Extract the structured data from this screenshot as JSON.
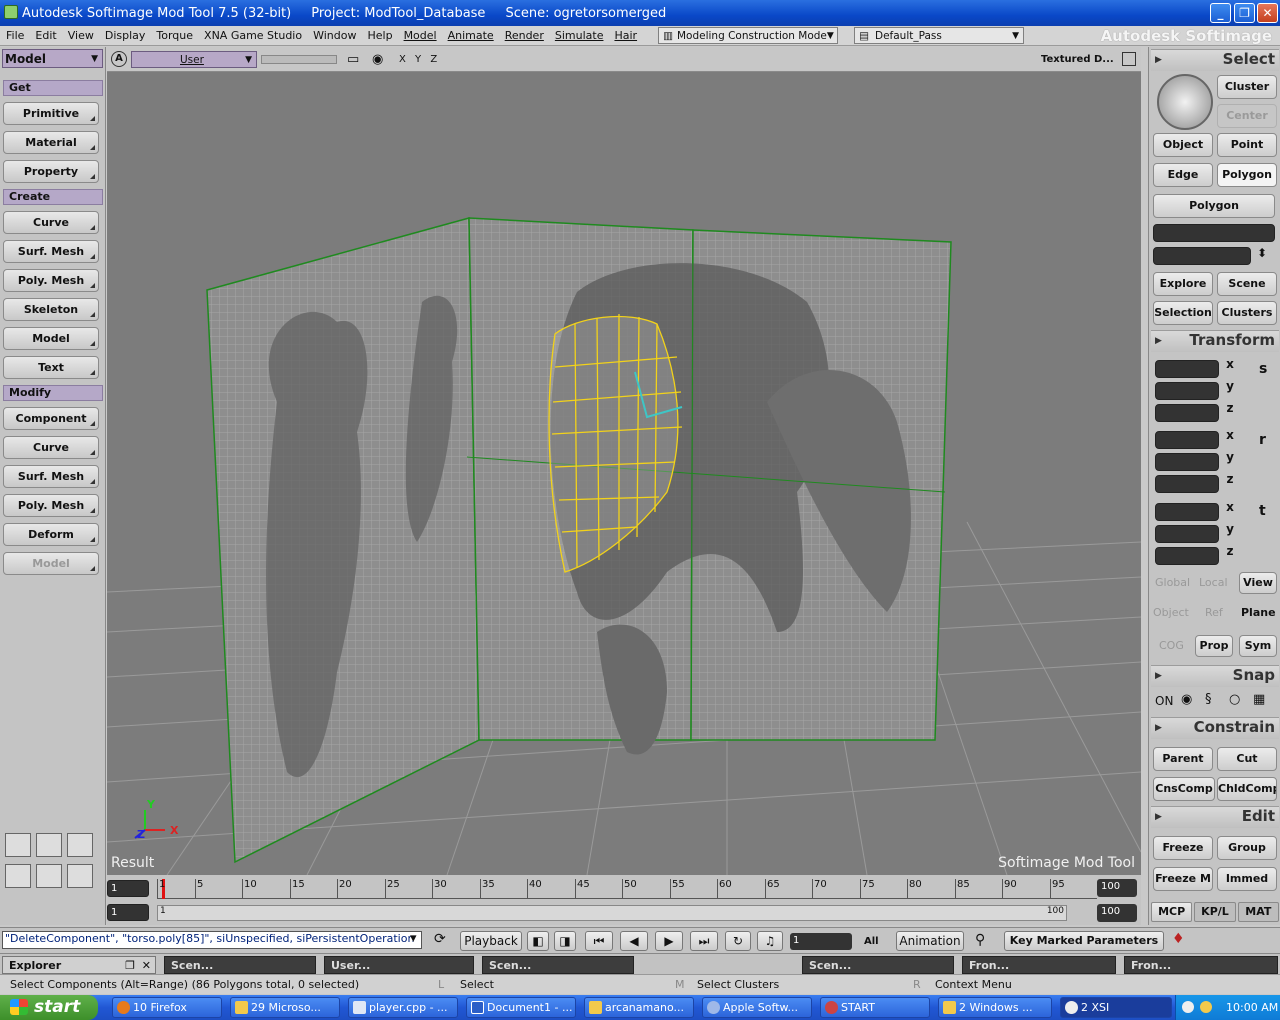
{
  "titlebar": {
    "app": "Autodesk Softimage Mod Tool 7.5 (32-bit)",
    "project": "Project: ModTool_Database",
    "scene": "Scene: ogretorsomerged"
  },
  "menubar": {
    "items": [
      "File",
      "Edit",
      "View",
      "Display",
      "Torque",
      "XNA Game Studio",
      "Window",
      "Help",
      "Model",
      "Animate",
      "Render",
      "Simulate",
      "Hair"
    ],
    "mode": "Modeling Construction Mode",
    "pass": "Default_Pass",
    "brand": "Autodesk Softimage"
  },
  "left": {
    "toolbar": "Model",
    "get_header": "Get",
    "get_items": [
      "Primitive",
      "Material",
      "Property"
    ],
    "create_header": "Create",
    "create_items": [
      "Curve",
      "Surf. Mesh",
      "Poly. Mesh",
      "Skeleton",
      "Model",
      "Text"
    ],
    "modify_header": "Modify",
    "modify_items": [
      "Component",
      "Curve",
      "Surf. Mesh",
      "Poly. Mesh",
      "Deform",
      "Model"
    ]
  },
  "viewport": {
    "camera": "User",
    "axes": "X Y Z",
    "display_mode": "Textured D...",
    "result_label": "Result",
    "watermark": "Softimage  Mod  Tool",
    "axis_x": "X",
    "axis_y": "Y",
    "axis_z": "Z"
  },
  "timeline": {
    "ticks": [
      "1",
      "5",
      "10",
      "15",
      "20",
      "25",
      "30",
      "35",
      "40",
      "45",
      "50",
      "55",
      "60",
      "65",
      "70",
      "75",
      "80",
      "85",
      "90",
      "95"
    ],
    "start": "1",
    "end": "100",
    "range_end": "100",
    "range_end2": "100",
    "range_start": "1",
    "current": "1"
  },
  "right": {
    "select_header": "Select",
    "cluster": "Cluster",
    "center": "Center",
    "object": "Object",
    "point": "Point",
    "edge": "Edge",
    "polygon": "Polygon",
    "polygon_menu": "Polygon",
    "explore": "Explore",
    "scene": "Scene",
    "selection": "Selection",
    "clusters": "Clusters",
    "transform_header": "Transform",
    "axes": [
      "x",
      "y",
      "z"
    ],
    "transform_icons": [
      "s",
      "r",
      "t"
    ],
    "global": "Global",
    "local": "Local",
    "view": "View",
    "object_ref": "Object",
    "ref": "Ref",
    "plane": "Plane",
    "cog": "COG",
    "prop": "Prop",
    "sym": "Sym",
    "snap_header": "Snap",
    "on": "ON",
    "constrain_header": "Constrain",
    "parent": "Parent",
    "cut": "Cut",
    "cnscomp": "CnsComp",
    "chldcomp": "ChldComp",
    "edit_header": "Edit",
    "freeze": "Freeze",
    "group": "Group",
    "freeze_m": "Freeze M",
    "immed": "Immed",
    "tabs": [
      "MCP",
      "KP/L",
      "MAT"
    ]
  },
  "command": {
    "line": "\"DeleteComponent\", \"torso.poly[85]\", siUnspecified, siPersistentOperation",
    "playback": "Playback",
    "frame": "1",
    "all": "All",
    "animation": "Animation",
    "key_marked": "Key Marked Parameters"
  },
  "tabs": {
    "explorer": "Explorer",
    "items": [
      "Scen...",
      "User...",
      "Scen...",
      "Scen...",
      "Fron...",
      "Fron..."
    ]
  },
  "status": {
    "message": "Select Components (Alt=Range) (86 Polygons total, 0 selected)",
    "l_label": "L",
    "l_action": "Select",
    "m_label": "M",
    "m_action": "Select Clusters",
    "r_label": "R",
    "r_action": "Context Menu"
  },
  "taskbar": {
    "start": "start",
    "tasks": [
      "10 Firefox",
      "29 Microso...",
      "player.cpp - ...",
      "Document1 - ...",
      "arcanamano...",
      "Apple Softw...",
      "START",
      "2 Windows ...",
      "2 XSI"
    ],
    "clock": "10:00 AM"
  },
  "colors": {
    "title_blue": "#0a48c8",
    "header_purple": "#b5a8c8",
    "viewport_gray": "#7c7c7c",
    "wire_yellow": "#f2d21a",
    "plane_green": "#1f8a1f"
  }
}
